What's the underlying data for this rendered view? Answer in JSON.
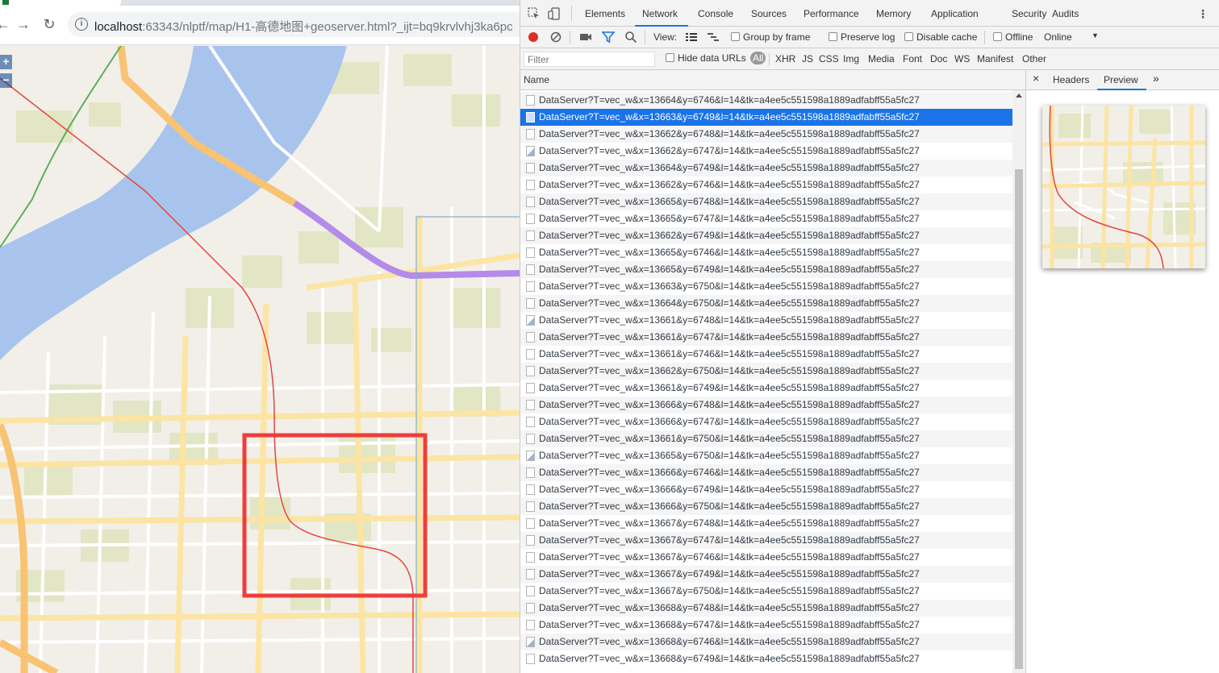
{
  "browser": {
    "url_host": "localhost",
    "url_path": ":63343/nlptf/map/H1-高德地图+geoserver.html?_ijt=bq9krvlvhj3ka6pc",
    "back_icon": "←",
    "forward_icon": "→",
    "reload_icon": "↻",
    "info_icon": "i"
  },
  "map": {
    "zoom_in": "+",
    "zoom_out": "−",
    "colors": {
      "background": "#f2efe9",
      "water": "#a9c4ec",
      "park": "#e2e6c4",
      "road_major": "#fce4a3",
      "road_arterial": "#f8c372",
      "railway_red": "#e2453f",
      "metro_purple": "#b48be8",
      "highlight_box": "#f03c3c"
    }
  },
  "devtools": {
    "tabs": [
      "Elements",
      "Network",
      "Console",
      "Sources",
      "Performance",
      "Memory",
      "Application",
      "Security",
      "Audits"
    ],
    "active_tab": "Network",
    "menu_icon": "⋮",
    "toolbar": {
      "view_label": "View:",
      "group_by_frame": "Group by frame",
      "preserve_log": "Preserve log",
      "disable_cache": "Disable cache",
      "offline": "Offline",
      "throttle": "Online",
      "throttle_arrow": "▼"
    },
    "filter": {
      "placeholder": "Filter",
      "hide_data_urls": "Hide data URLs",
      "types": [
        "All",
        "XHR",
        "JS",
        "CSS",
        "Img",
        "Media",
        "Font",
        "Doc",
        "WS",
        "Manifest",
        "Other"
      ],
      "active_type": "All"
    },
    "list_header": "Name",
    "requests": [
      {
        "name": "DataServer?T=vec_w&x=13664&y=6746&l=14&tk=a4ee5c551598a1889adfabff55a5fc27",
        "icon": "doc"
      },
      {
        "name": "DataServer?T=vec_w&x=13663&y=6749&l=14&tk=a4ee5c551598a1889adfabff55a5fc27",
        "icon": "doc",
        "selected": true
      },
      {
        "name": "DataServer?T=vec_w&x=13662&y=6748&l=14&tk=a4ee5c551598a1889adfabff55a5fc27",
        "icon": "doc"
      },
      {
        "name": "DataServer?T=vec_w&x=13662&y=6747&l=14&tk=a4ee5c551598a1889adfabff55a5fc27",
        "icon": "img"
      },
      {
        "name": "DataServer?T=vec_w&x=13664&y=6749&l=14&tk=a4ee5c551598a1889adfabff55a5fc27",
        "icon": "doc"
      },
      {
        "name": "DataServer?T=vec_w&x=13662&y=6746&l=14&tk=a4ee5c551598a1889adfabff55a5fc27",
        "icon": "doc"
      },
      {
        "name": "DataServer?T=vec_w&x=13665&y=6748&l=14&tk=a4ee5c551598a1889adfabff55a5fc27",
        "icon": "doc"
      },
      {
        "name": "DataServer?T=vec_w&x=13665&y=6747&l=14&tk=a4ee5c551598a1889adfabff55a5fc27",
        "icon": "doc"
      },
      {
        "name": "DataServer?T=vec_w&x=13662&y=6749&l=14&tk=a4ee5c551598a1889adfabff55a5fc27",
        "icon": "doc"
      },
      {
        "name": "DataServer?T=vec_w&x=13665&y=6746&l=14&tk=a4ee5c551598a1889adfabff55a5fc27",
        "icon": "doc"
      },
      {
        "name": "DataServer?T=vec_w&x=13665&y=6749&l=14&tk=a4ee5c551598a1889adfabff55a5fc27",
        "icon": "doc"
      },
      {
        "name": "DataServer?T=vec_w&x=13663&y=6750&l=14&tk=a4ee5c551598a1889adfabff55a5fc27",
        "icon": "doc"
      },
      {
        "name": "DataServer?T=vec_w&x=13664&y=6750&l=14&tk=a4ee5c551598a1889adfabff55a5fc27",
        "icon": "doc"
      },
      {
        "name": "DataServer?T=vec_w&x=13661&y=6748&l=14&tk=a4ee5c551598a1889adfabff55a5fc27",
        "icon": "img"
      },
      {
        "name": "DataServer?T=vec_w&x=13661&y=6747&l=14&tk=a4ee5c551598a1889adfabff55a5fc27",
        "icon": "doc"
      },
      {
        "name": "DataServer?T=vec_w&x=13661&y=6746&l=14&tk=a4ee5c551598a1889adfabff55a5fc27",
        "icon": "doc"
      },
      {
        "name": "DataServer?T=vec_w&x=13662&y=6750&l=14&tk=a4ee5c551598a1889adfabff55a5fc27",
        "icon": "doc"
      },
      {
        "name": "DataServer?T=vec_w&x=13661&y=6749&l=14&tk=a4ee5c551598a1889adfabff55a5fc27",
        "icon": "doc"
      },
      {
        "name": "DataServer?T=vec_w&x=13666&y=6748&l=14&tk=a4ee5c551598a1889adfabff55a5fc27",
        "icon": "doc"
      },
      {
        "name": "DataServer?T=vec_w&x=13666&y=6747&l=14&tk=a4ee5c551598a1889adfabff55a5fc27",
        "icon": "doc"
      },
      {
        "name": "DataServer?T=vec_w&x=13661&y=6750&l=14&tk=a4ee5c551598a1889adfabff55a5fc27",
        "icon": "doc"
      },
      {
        "name": "DataServer?T=vec_w&x=13665&y=6750&l=14&tk=a4ee5c551598a1889adfabff55a5fc27",
        "icon": "img"
      },
      {
        "name": "DataServer?T=vec_w&x=13666&y=6746&l=14&tk=a4ee5c551598a1889adfabff55a5fc27",
        "icon": "doc"
      },
      {
        "name": "DataServer?T=vec_w&x=13666&y=6749&l=14&tk=a4ee5c551598a1889adfabff55a5fc27",
        "icon": "doc"
      },
      {
        "name": "DataServer?T=vec_w&x=13666&y=6750&l=14&tk=a4ee5c551598a1889adfabff55a5fc27",
        "icon": "doc"
      },
      {
        "name": "DataServer?T=vec_w&x=13667&y=6748&l=14&tk=a4ee5c551598a1889adfabff55a5fc27",
        "icon": "doc"
      },
      {
        "name": "DataServer?T=vec_w&x=13667&y=6747&l=14&tk=a4ee5c551598a1889adfabff55a5fc27",
        "icon": "doc"
      },
      {
        "name": "DataServer?T=vec_w&x=13667&y=6746&l=14&tk=a4ee5c551598a1889adfabff55a5fc27",
        "icon": "doc"
      },
      {
        "name": "DataServer?T=vec_w&x=13667&y=6749&l=14&tk=a4ee5c551598a1889adfabff55a5fc27",
        "icon": "doc"
      },
      {
        "name": "DataServer?T=vec_w&x=13667&y=6750&l=14&tk=a4ee5c551598a1889adfabff55a5fc27",
        "icon": "doc"
      },
      {
        "name": "DataServer?T=vec_w&x=13668&y=6748&l=14&tk=a4ee5c551598a1889adfabff55a5fc27",
        "icon": "doc"
      },
      {
        "name": "DataServer?T=vec_w&x=13668&y=6747&l=14&tk=a4ee5c551598a1889adfabff55a5fc27",
        "icon": "doc"
      },
      {
        "name": "DataServer?T=vec_w&x=13668&y=6746&l=14&tk=a4ee5c551598a1889adfabff55a5fc27",
        "icon": "img"
      },
      {
        "name": "DataServer?T=vec_w&x=13668&y=6749&l=14&tk=a4ee5c551598a1889adfabff55a5fc27",
        "icon": "doc"
      }
    ],
    "preview": {
      "close_icon": "×",
      "tabs": [
        "Headers",
        "Preview"
      ],
      "active_tab": "Preview",
      "more_icon": "»"
    },
    "colors": {
      "accent": "#1a73e8",
      "record_red": "#d93025",
      "panel_bg": "#f3f3f3"
    }
  }
}
